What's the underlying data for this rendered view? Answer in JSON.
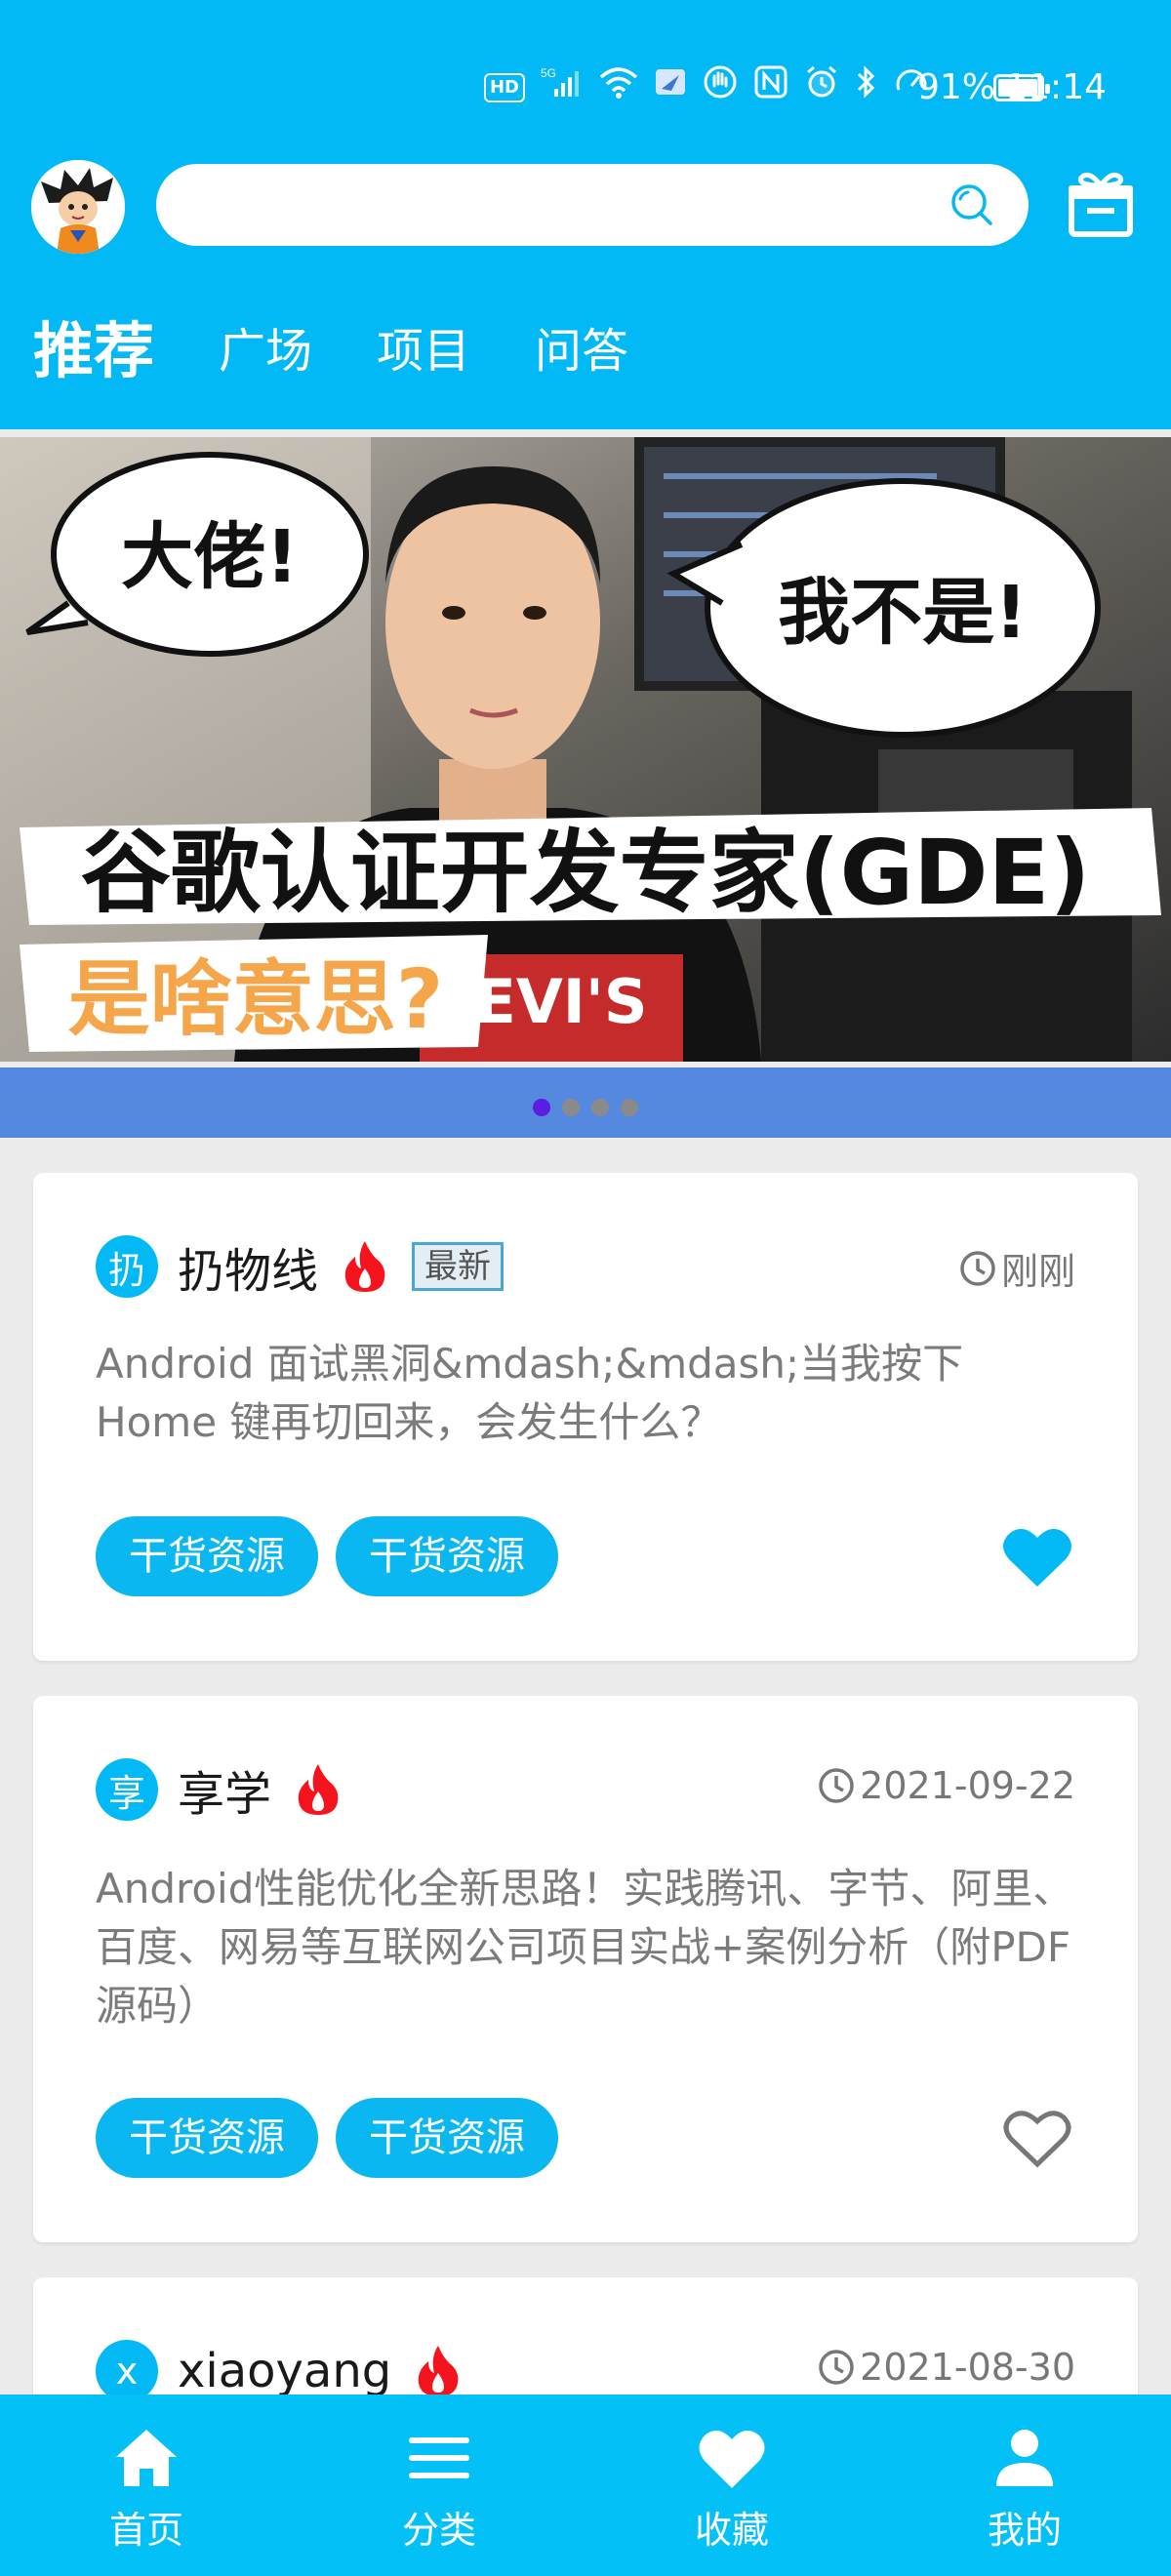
{
  "status_bar": {
    "network_badge": "HD",
    "signal": "5G",
    "battery_percent": "91%",
    "time": "11:14"
  },
  "search": {
    "placeholder": ""
  },
  "tabs": [
    {
      "label": "推荐",
      "active": true
    },
    {
      "label": "广场",
      "active": false
    },
    {
      "label": "项目",
      "active": false
    },
    {
      "label": "问答",
      "active": false
    }
  ],
  "banner": {
    "bubble_left": "大佬!",
    "bubble_right": "我不是!",
    "headline": "谷歌认证开发专家(GDE)",
    "subheadline": "是啥意思?",
    "shirt_text": "EVI'S",
    "page_count": 4,
    "current_page": 1
  },
  "cards": [
    {
      "avatar_char": "扔",
      "author": "扔物线",
      "hot": true,
      "new_tag": "最新",
      "time": "刚刚",
      "title": "Android 面试黑洞&mdash;&mdash;当我按下 Home 键再切回来，会发生什么？",
      "tags": [
        "干货资源",
        "干货资源"
      ],
      "liked": true
    },
    {
      "avatar_char": "享",
      "author": "享学",
      "hot": true,
      "new_tag": "",
      "time": "2021-09-22",
      "title": "Android性能优化全新思路！实践腾讯、字节、阿里、百度、网易等互联网公司项目实战+案例分析（附PDF源码）",
      "tags": [
        "干货资源",
        "干货资源"
      ],
      "liked": false
    },
    {
      "avatar_char": "x",
      "author": "xiaoyang",
      "hot": true,
      "new_tag": "",
      "time": "2021-08-30",
      "title": "",
      "tags": [],
      "liked": false
    }
  ],
  "bottom_nav": [
    {
      "label": "首页",
      "icon": "home-icon"
    },
    {
      "label": "分类",
      "icon": "menu-icon"
    },
    {
      "label": "收藏",
      "icon": "heart-icon"
    },
    {
      "label": "我的",
      "icon": "person-icon"
    }
  ],
  "colors": {
    "primary": "#03b9f5",
    "chip": "#0ab7f0",
    "indicator_bar": "#5588df",
    "hot": "#f5141e"
  }
}
